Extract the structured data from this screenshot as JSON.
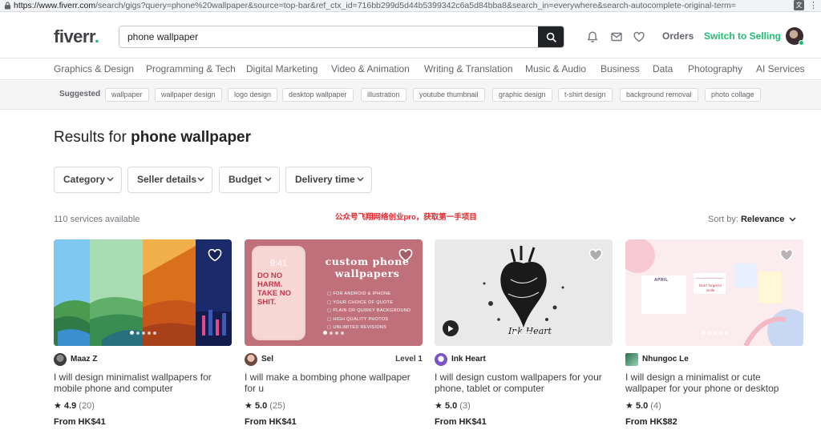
{
  "browser": {
    "url_host": "https://www.fiverr.com",
    "url_path": "/search/gigs?query=phone%20wallpaper&source=top-bar&ref_ctx_id=716bb299d5d44b5399342c6a5d84bba8&search_in=everywhere&search-autocomplete-original-term="
  },
  "header": {
    "logo": "fiverr",
    "logo_dot": ".",
    "search_value": "phone wallpaper",
    "orders": "Orders",
    "switch": "Switch to Selling"
  },
  "categories": [
    "Graphics & Design",
    "Programming & Tech",
    "Digital Marketing",
    "Video & Animation",
    "Writing & Translation",
    "Music & Audio",
    "Business",
    "Data",
    "Photography",
    "AI Services"
  ],
  "suggested": {
    "label": "Suggested",
    "chips": [
      "wallpaper",
      "wallpaper design",
      "logo design",
      "desktop wallpaper",
      "illustration",
      "youtube thumbnail",
      "graphic design",
      "t-shirt design",
      "background removal",
      "photo collage"
    ]
  },
  "results": {
    "prefix": "Results for",
    "query": "phone wallpaper",
    "count": "110 services available",
    "sort_label": "Sort by:",
    "sort_value": "Relevance"
  },
  "filters": [
    "Category",
    "Seller details",
    "Budget",
    "Delivery time"
  ],
  "watermark": "公众号飞翔网络创业pro，获取第一手项目",
  "gigs": [
    {
      "seller": "Maaz Z",
      "level": "",
      "title": "I will design minimalist wallpapers for mobile phone and computer",
      "rating": "4.9",
      "reviews": "(20)",
      "price": "From HK$41"
    },
    {
      "seller": "Sel",
      "level": "Level 1",
      "title": "I will make a bombing phone wallpaper for u",
      "rating": "5.0",
      "reviews": "(25)",
      "price": "From HK$41",
      "thumb_text": {
        "heading": "custom phone wallpapers",
        "bullets": [
          "FOR ANDROID & IPHONE",
          "YOUR CHOICE OF QUOTE",
          "PLAIN OR QUIRKY BACKGROUND",
          "HIGH QUALITY PHOTOS",
          "UNLIMITED REVISIONS"
        ],
        "phone_time": "9:41",
        "phone_quote": "DO NO HARM. TAKE NO SHIT."
      }
    },
    {
      "seller": "Ink Heart",
      "level": "",
      "title": "I will design custom wallpapers for your phone, tablet or computer",
      "rating": "5.0",
      "reviews": "(3)",
      "price": "From HK$41"
    },
    {
      "seller": "Nhungoc Le",
      "level": "",
      "title": "I will design a minimalist or cute wallpaper for your phone or desktop",
      "rating": "5.0",
      "reviews": "(4)",
      "price": "From HK$82",
      "thumb_text": {
        "month": "APRIL",
        "note": "Don't forget to smile"
      }
    }
  ],
  "colors": {
    "brand_green": "#1dbf73",
    "text_dark": "#222325",
    "text_mid": "#404145",
    "text_light": "#74767e"
  }
}
